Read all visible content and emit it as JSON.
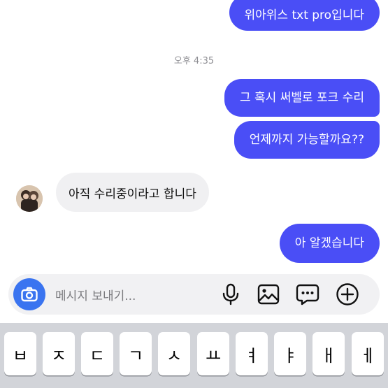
{
  "messages": {
    "out1": "위아위스 txt pro입니다",
    "timestamp": "오후 4:35",
    "out2": "그 혹시 써벨로 포크 수리",
    "out3": "언제까지 가능할까요??",
    "in1": "아직 수리중이라고 합니다",
    "out4": "아 알겠습니다"
  },
  "composer": {
    "placeholder": "메시지 보내기..."
  },
  "keyboard": {
    "row1": [
      "ㅂ",
      "ㅈ",
      "ㄷ",
      "ㄱ",
      "ㅅ",
      "ㅛ",
      "ㅕ",
      "ㅑ",
      "ㅐ",
      "ㅔ"
    ]
  },
  "colors": {
    "outgoing_bubble": "#4a4ef6",
    "incoming_bubble": "#f0f0f2",
    "camera_button": "#3a74f0",
    "keyboard_bg": "#d2d4d9"
  },
  "icons": [
    "camera-icon",
    "microphone-icon",
    "image-icon",
    "sticker-icon",
    "plus-icon"
  ]
}
